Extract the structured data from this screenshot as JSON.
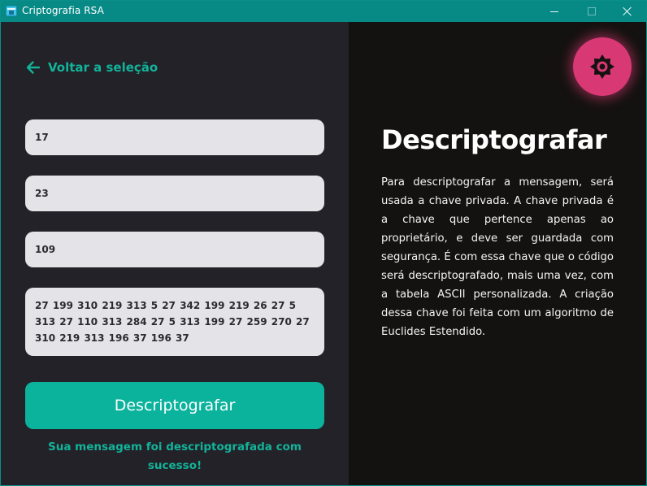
{
  "window": {
    "title": "Criptografia RSA"
  },
  "nav": {
    "back_label": "Voltar a seleção"
  },
  "form": {
    "field_1": "17",
    "field_2": "23",
    "field_3": "109",
    "field_4": "27 199 310 219 313 5 27 342 199 219 26 27 5 313 27 110 313 284 27 5 313 199 27 259 270 27 310 219 313 196 37 196 37",
    "submit_label": "Descriptografar",
    "status": "Sua mensagem foi descriptografada com sucesso!"
  },
  "info": {
    "heading": "Descriptografar",
    "description": "Para descriptografar a mensagem, será usada a chave privada. A chave privada é a chave que pertence apenas ao proprietário, e deve ser guardada com segurança. É com essa chave que o código será descriptografado, mais uma vez, com a tabela ASCII personalizada. A criação dessa chave foi feita com um algoritmo de Euclides Estendido."
  },
  "icons": {
    "app": "app-window-icon",
    "back": "arrow-left-icon",
    "settings": "gear-icon"
  },
  "colors": {
    "accent": "#0bb39d",
    "titlebar": "#078a86",
    "left_panel": "#222228",
    "right_panel": "#141210",
    "settings_button": "#d83873",
    "field_background": "#e4e4e8"
  }
}
